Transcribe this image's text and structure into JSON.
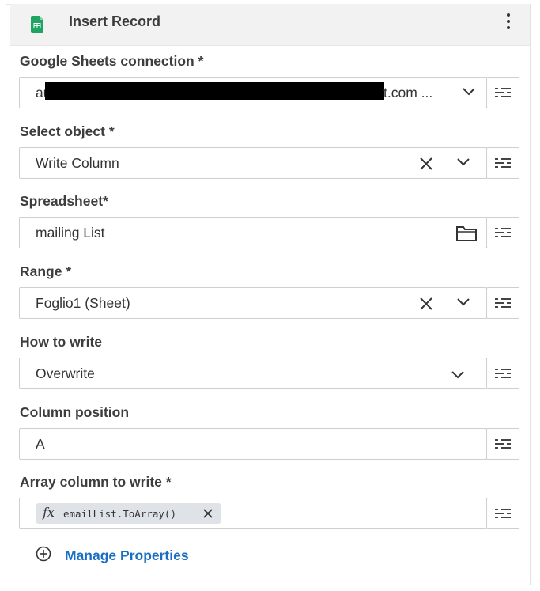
{
  "header": {
    "title": "Insert Record",
    "icon": "google-sheets-icon",
    "menu_icon": "kebab-menu-icon"
  },
  "colors": {
    "accent": "#e06b5a",
    "sheets_green": "#1fa463",
    "link": "#1a6fc4"
  },
  "fields": {
    "connection": {
      "label": "Google Sheets connection *",
      "value_start": "au",
      "value_end": "t.com ..."
    },
    "object": {
      "label": "Select object *",
      "value": "Write Column"
    },
    "spreadsheet": {
      "label": "Spreadsheet*",
      "value": "mailing List"
    },
    "range": {
      "label": "Range *",
      "value": "Foglio1 (Sheet)"
    },
    "how_to_write": {
      "label": "How to write",
      "value": "Overwrite"
    },
    "column_position": {
      "label": "Column position",
      "value": "A"
    },
    "array_column": {
      "label": "Array column to write *",
      "chip_fx": "fx",
      "chip_value": "emailList.ToArray()"
    }
  },
  "manage_properties": {
    "label": "Manage Properties"
  }
}
